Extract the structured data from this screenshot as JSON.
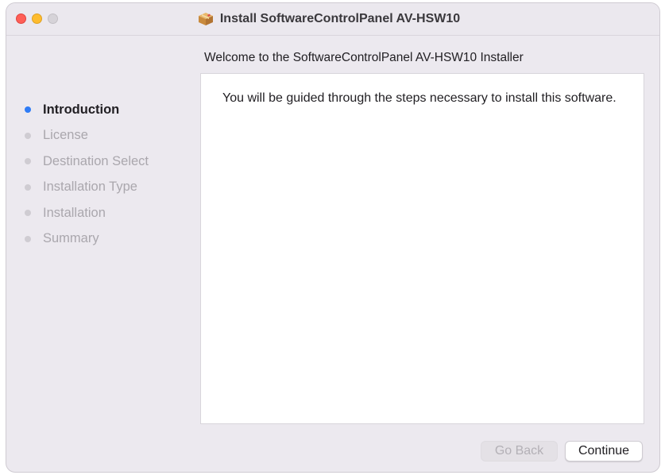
{
  "window": {
    "title": "Install SoftwareControlPanel AV-HSW10"
  },
  "heading": "Welcome to the SoftwareControlPanel AV-HSW10 Installer",
  "steps": [
    {
      "label": "Introduction",
      "active": true
    },
    {
      "label": "License",
      "active": false
    },
    {
      "label": "Destination Select",
      "active": false
    },
    {
      "label": "Installation Type",
      "active": false
    },
    {
      "label": "Installation",
      "active": false
    },
    {
      "label": "Summary",
      "active": false
    }
  ],
  "content": {
    "text": "You will be guided through the steps necessary to install this software."
  },
  "buttons": {
    "go_back": "Go Back",
    "continue": "Continue"
  },
  "colors": {
    "active_step": "#2f7cf6",
    "close": "#ff5f57",
    "minimize": "#febc2e"
  },
  "icons": {
    "title": "package-icon"
  }
}
